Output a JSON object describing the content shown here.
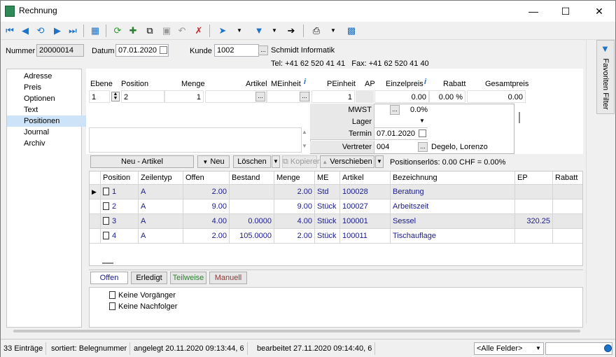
{
  "window": {
    "title": "Rechnung"
  },
  "header": {
    "nummer_label": "Nummer",
    "nummer_value": "20000014",
    "datum_label": "Datum",
    "datum_value": "07.01.2020",
    "kunde_label": "Kunde",
    "kunde_value": "1002",
    "kunde_name": "Schmidt Informatik",
    "kunde_contact": "Tel: +41 62 520 41 41   Fax: +41 62 520 41 40"
  },
  "nav": {
    "items": [
      "Adresse",
      "Preis",
      "Optionen",
      "Text",
      "Positionen",
      "Journal",
      "Archiv"
    ]
  },
  "favorites_tab": "Favoriten Filter",
  "position_form": {
    "labels": {
      "ebene": "Ebene",
      "position": "Position",
      "menge": "Menge",
      "artikel": "Artikel",
      "meinheit": "MEinheit",
      "peinheit": "PEinheit",
      "ap": "AP",
      "einzelpreis": "Einzelpreis",
      "rabatt": "Rabatt",
      "gesamtpreis": "Gesamtpreis"
    },
    "values": {
      "ebene": "1",
      "position": "2",
      "menge": "1",
      "peinheit": "1",
      "einzelpreis": "0.00",
      "rabatt": "0.00 %",
      "gesamtpreis": "0.00"
    },
    "details": {
      "mwst_label": "MWST",
      "mwst_value": "0.0%",
      "lager_label": "Lager",
      "termin_label": "Termin",
      "termin_value": "07.01.2020",
      "vertreter_label": "Vertreter",
      "vertreter_value": "004",
      "vertreter_name": "Degelo, Lorenzo"
    }
  },
  "actions": {
    "neu_artikel": "Neu - Artikel",
    "neu": "Neu",
    "loeschen": "Löschen",
    "kopieren": "Kopieren",
    "verschieben": "Verschieben",
    "positionserloes": "Positionserlös:  0.00 CHF = 0.00%"
  },
  "table": {
    "columns": [
      "Position",
      "Zeilentyp",
      "Offen",
      "Bestand",
      "Menge",
      "ME",
      "Artikel",
      "Bezeichnung",
      "EP",
      "Rabatt"
    ],
    "rows": [
      {
        "position": "1",
        "zeilentyp": "A",
        "offen": "2.00",
        "bestand": "",
        "menge": "2.00",
        "me": "Std",
        "artikel": "100028",
        "bezeichnung": "Beratung",
        "ep": "",
        "rabatt": ""
      },
      {
        "position": "2",
        "zeilentyp": "A",
        "offen": "9.00",
        "bestand": "",
        "menge": "9.00",
        "me": "Stück",
        "artikel": "100027",
        "bezeichnung": "Arbeitszeit",
        "ep": "",
        "rabatt": ""
      },
      {
        "position": "3",
        "zeilentyp": "A",
        "offen": "4.00",
        "bestand": "0.0000",
        "menge": "4.00",
        "me": "Stück",
        "artikel": "100001",
        "bezeichnung": "Sessel",
        "ep": "320.25",
        "rabatt": ""
      },
      {
        "position": "4",
        "zeilentyp": "A",
        "offen": "2.00",
        "bestand": "105.0000",
        "menge": "2.00",
        "me": "Stück",
        "artikel": "100011",
        "bezeichnung": "Tischauflage",
        "ep": "",
        "rabatt": ""
      }
    ]
  },
  "filter_tabs": [
    "Offen",
    "Erledigt",
    "Teilweise",
    "Manuell"
  ],
  "tree": [
    "Keine Vorgänger",
    "Keine Nachfolger"
  ],
  "status": {
    "count": "33 Einträge",
    "sort": "sortiert: Belegnummer",
    "created": "angelegt 20.11.2020 09:13:44,  6",
    "edited": "bearbeitet 27.11.2020 09:14:40,  6",
    "field_select": "<Alle Felder>"
  },
  "colors": {
    "accent": "#1e72c8",
    "selection": "#cde3f7",
    "row_alt": "#e8e8e8",
    "link_text": "#1a1a8c"
  }
}
